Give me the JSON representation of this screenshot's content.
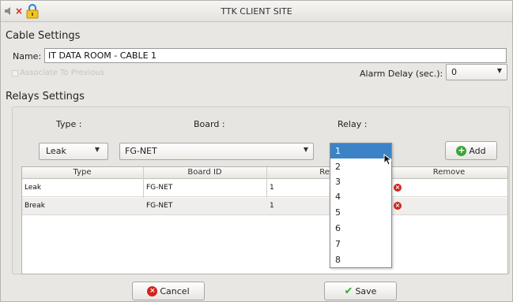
{
  "window": {
    "title": "TTK CLIENT SITE"
  },
  "colors": {
    "accent": "#3b83c6",
    "add_green": "#3aa63a",
    "remove_red": "#d3231d"
  },
  "cable_settings": {
    "title": "Cable Settings",
    "name_label": "Name:",
    "name_value": "IT DATA ROOM - CABLE 1",
    "associate_label": "Associate To Previous",
    "associate_checked": false,
    "alarm_delay_label": "Alarm Delay (sec.):",
    "alarm_delay_value": "0"
  },
  "relays_settings": {
    "title": "Relays Settings",
    "type_label": "Type :",
    "board_label": "Board :",
    "relay_label": "Relay :",
    "type_value": "Leak",
    "board_value": "FG-NET",
    "add_label": "Add",
    "relay_options": [
      "1",
      "2",
      "3",
      "4",
      "5",
      "6",
      "7",
      "8"
    ],
    "relay_selected": "1",
    "table": {
      "headers": [
        "Type",
        "Board ID",
        "Rela",
        "Remove"
      ],
      "rows": [
        {
          "type": "Leak",
          "board_id": "FG-NET",
          "relay": "1"
        },
        {
          "type": "Break",
          "board_id": "FG-NET",
          "relay": "1"
        }
      ]
    }
  },
  "footer": {
    "cancel_label": "Cancel",
    "save_label": "Save"
  }
}
